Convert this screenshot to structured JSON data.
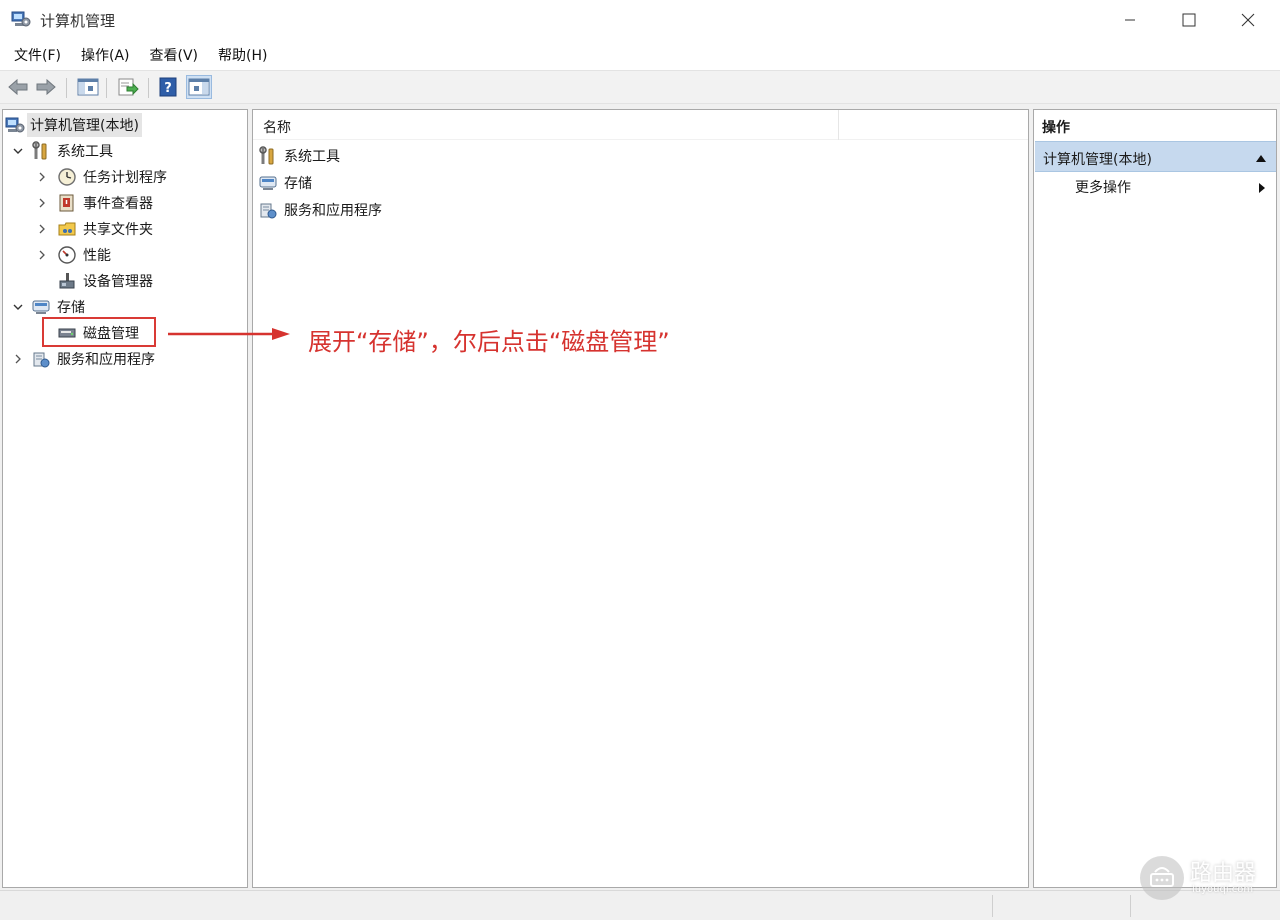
{
  "window": {
    "title": "计算机管理",
    "controls": {
      "minimize": "minimize-icon",
      "maximize": "maximize-icon",
      "close": "close-icon"
    }
  },
  "menu": [
    "文件(F)",
    "操作(A)",
    "查看(V)",
    "帮助(H)"
  ],
  "toolbar": {
    "icons": [
      "back-arrow-icon",
      "forward-arrow-icon",
      "show-hide-console-tree-icon",
      "export-list-icon",
      "help-icon",
      "show-hide-action-pane-icon"
    ]
  },
  "tree": {
    "root": "计算机管理(本地)",
    "system_tools": {
      "label": "系统工具",
      "children": [
        "任务计划程序",
        "事件查看器",
        "共享文件夹",
        "性能",
        "设备管理器"
      ]
    },
    "storage": {
      "label": "存储",
      "children": [
        "磁盘管理"
      ]
    },
    "services": "服务和应用程序"
  },
  "list": {
    "column_name": "名称",
    "items": [
      "系统工具",
      "存储",
      "服务和应用程序"
    ]
  },
  "actions": {
    "title": "操作",
    "section": "计算机管理(本地)",
    "more": "更多操作"
  },
  "annotation": {
    "text": "展开“存储”，尔后点击“磁盘管理”",
    "color": "#d6332f"
  },
  "watermark": {
    "text": "路由器",
    "sub": "luyouqi.com"
  }
}
